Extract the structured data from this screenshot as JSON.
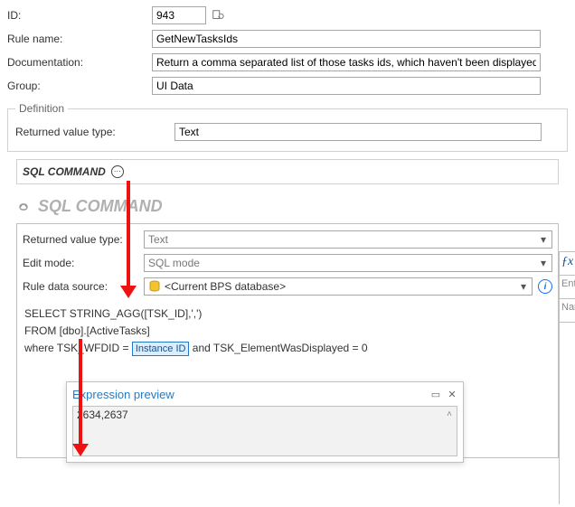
{
  "form": {
    "id_label": "ID:",
    "id_value": "943",
    "rule_name_label": "Rule name:",
    "rule_name_value": "GetNewTasksIds",
    "doc_label": "Documentation:",
    "doc_value": "Return a comma separated list of those tasks ids, which haven't been displayed to a user.",
    "group_label": "Group:",
    "group_value": "UI Data"
  },
  "definition": {
    "legend": "Definition",
    "returned_label": "Returned value type:",
    "returned_value": "Text",
    "tab_label": "SQL COMMAND",
    "section_title": "SQL COMMAND"
  },
  "editor": {
    "returned_label": "Returned value type:",
    "returned_value": "Text",
    "edit_mode_label": "Edit mode:",
    "edit_mode_value": "SQL mode",
    "datasource_label": "Rule data source:",
    "datasource_value": "<Current BPS database>",
    "sql_line1": "SELECT STRING_AGG([TSK_ID],',')",
    "sql_line2": "FROM [dbo].[ActiveTasks]",
    "sql_line3a": "where TSK_WFDID = ",
    "sql_token": "Instance ID",
    "sql_line3b": " and TSK_ElementWasDisplayed = 0"
  },
  "preview": {
    "title": "Expression preview",
    "result": "2634,2637"
  },
  "side": {
    "fx": "ƒx",
    "ent": "Ent",
    "nar": "Nar"
  }
}
